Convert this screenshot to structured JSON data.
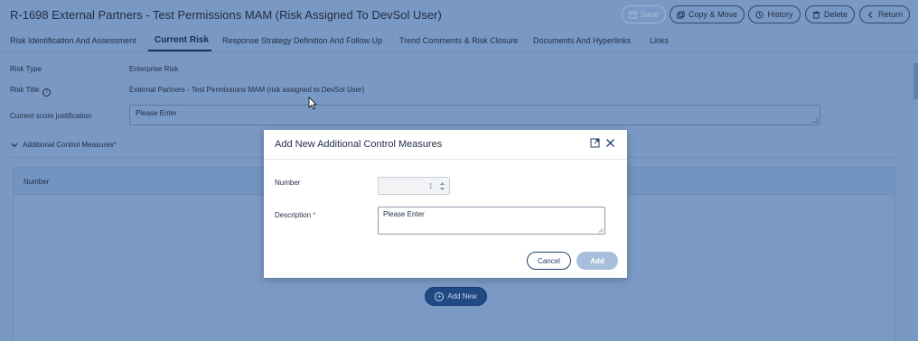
{
  "header": {
    "title": "R-1698 External Partners - Test Permissions MAM (Risk Assigned To DevSol User)",
    "buttons": {
      "save": "Save",
      "copy_move": "Copy & Move",
      "history": "History",
      "delete": "Delete",
      "return": "Return"
    }
  },
  "tabs": [
    {
      "label": "Risk Identification And Assessment"
    },
    {
      "label": "Current Risk",
      "active": true
    },
    {
      "label": "Response Strategy Definition And Follow Up"
    },
    {
      "label": "Trend Comments & Risk Closure"
    },
    {
      "label": "Documents And Hyperlinks"
    },
    {
      "label": "Links"
    }
  ],
  "form": {
    "risk_type_label": "Risk Type",
    "risk_type_value": "Enterprise Risk",
    "risk_title_label": "Risk Title",
    "risk_title_value": "External Partners - Test Permissions MAM (risk assigned to DevSol User)",
    "justification_label": "Current score justification",
    "justification_placeholder": "Please Enter"
  },
  "section": {
    "title": "Additional Control Measures",
    "required_mark": "*",
    "table_headers": [
      "Number"
    ],
    "add_new_label": "Add New"
  },
  "modal": {
    "title": "Add New Additional Control Measures",
    "number_label": "Number",
    "number_value": "1",
    "description_label": "Description",
    "required_mark": "*",
    "description_placeholder": "Please Enter",
    "cancel_label": "Cancel",
    "add_label": "Add"
  },
  "colors": {
    "overlay_bg": "#7a98c4",
    "primary": "#1f4a86",
    "required": "#c0392b",
    "add_disabled": "#a7bfdc"
  }
}
